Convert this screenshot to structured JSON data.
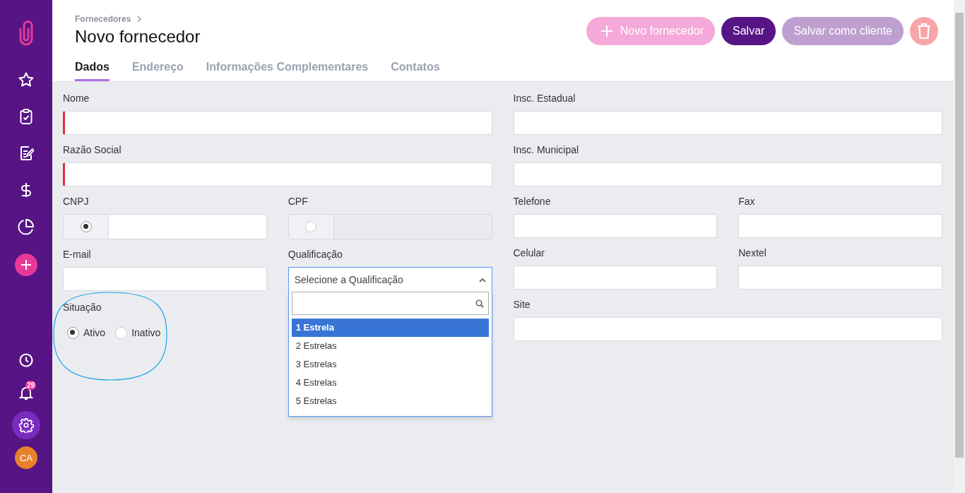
{
  "sidebar": {
    "nav_items": [
      {
        "selected": false
      },
      {
        "selected": false
      },
      {
        "selected": false
      },
      {
        "selected": false
      },
      {
        "selected": false
      }
    ],
    "bottom_items": [
      {
        "selected": false
      },
      {
        "selected": false,
        "badge": "29"
      },
      {
        "selected": true
      }
    ],
    "avatar": "CA"
  },
  "header": {
    "breadcrumb": "Fornecedores",
    "title": "Novo fornecedor",
    "buttons": [
      {
        "kind": "add",
        "label": "Novo fornecedor"
      },
      {
        "kind": "primary",
        "label": "Salvar"
      },
      {
        "kind": "secondary",
        "label": "Salvar como cliente"
      },
      {
        "kind": "delete"
      }
    ],
    "tabs": [
      {
        "label": "Dados",
        "selected": true
      },
      {
        "label": "Endereço",
        "selected": false
      },
      {
        "label": "Informações Complementares",
        "selected": false
      },
      {
        "label": "Contatos",
        "selected": false
      }
    ]
  },
  "form": {
    "left": [
      [
        {
          "kind": "text",
          "label": "Nome",
          "required": true
        }
      ],
      [
        {
          "kind": "text",
          "label": "Razão Social",
          "required": true
        }
      ],
      [
        {
          "kind": "radio_text",
          "label": "CNPJ",
          "checked": true
        },
        {
          "kind": "radio_text",
          "label": "CPF",
          "checked": false
        }
      ],
      [
        {
          "kind": "text",
          "label": "E-mail",
          "required": false
        },
        {
          "kind": "select",
          "label": "Qualificação",
          "placeholder": "Selecione a Qualificação",
          "expanded": true,
          "options": [
            {
              "label": "1 Estrela",
              "selected": true
            },
            {
              "label": "2 Estrelas",
              "selected": false
            },
            {
              "label": "3 Estrelas",
              "selected": false
            },
            {
              "label": "4 Estrelas",
              "selected": false
            },
            {
              "label": "5 Estrelas",
              "selected": false
            }
          ]
        }
      ],
      [
        {
          "kind": "radio_group",
          "label": "Situação",
          "options": [
            {
              "label": "Ativo",
              "selected": true
            },
            {
              "label": "Inativo",
              "selected": false
            }
          ]
        }
      ]
    ],
    "right": [
      [
        {
          "kind": "text",
          "label": "Insc. Estadual",
          "required": false
        }
      ],
      [
        {
          "kind": "text",
          "label": "Insc. Municipal",
          "required": false
        }
      ],
      [
        {
          "kind": "text",
          "label": "Telefone",
          "required": false
        },
        {
          "kind": "text",
          "label": "Fax",
          "required": false
        }
      ],
      [
        {
          "kind": "text",
          "label": "Celular",
          "required": false
        },
        {
          "kind": "text",
          "label": "Nextel",
          "required": false
        }
      ],
      [
        {
          "kind": "text",
          "label": "Site",
          "required": false
        }
      ]
    ]
  }
}
